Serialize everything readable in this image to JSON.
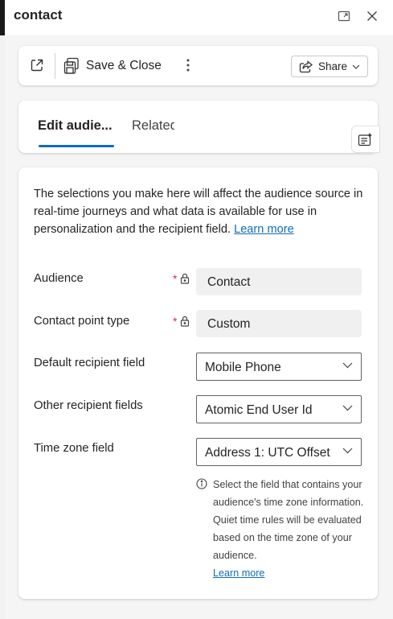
{
  "window": {
    "title": "contact",
    "expand_icon": "expand-icon",
    "close_icon": "close-icon"
  },
  "commandbar": {
    "popout_icon": "open-in-new-window-icon",
    "save_close_label": "Save & Close",
    "more_icon": "more-vertical-icon",
    "share_label": "Share"
  },
  "tabs": [
    {
      "label": "Edit audie...",
      "selected": true
    },
    {
      "label": "Related",
      "selected": false
    }
  ],
  "form": {
    "intro_text": "The selections you make here will affect the audience source in real-time journeys and what data is available for use in personalization and the recipient field.",
    "intro_link": "Learn more",
    "rows": [
      {
        "label": "Audience",
        "value": "Contact",
        "required": true,
        "locked": true
      },
      {
        "label": "Contact point type",
        "value": "Custom",
        "required": true,
        "locked": true
      },
      {
        "label": "Default recipient field",
        "value": "Mobile Phone"
      },
      {
        "label": "Other recipient fields",
        "value": "Atomic End User Id"
      },
      {
        "label": "Time zone field",
        "value": "Address 1: UTC Offset"
      }
    ],
    "required_mark": "*",
    "help_text": "Select the field that contains your audience's time zone information. Quiet time rules will be evaluated based on the time zone of your audience.",
    "help_link": "Learn more"
  },
  "colors": {
    "accent": "#0f6cbd",
    "required": "#c4314b"
  }
}
